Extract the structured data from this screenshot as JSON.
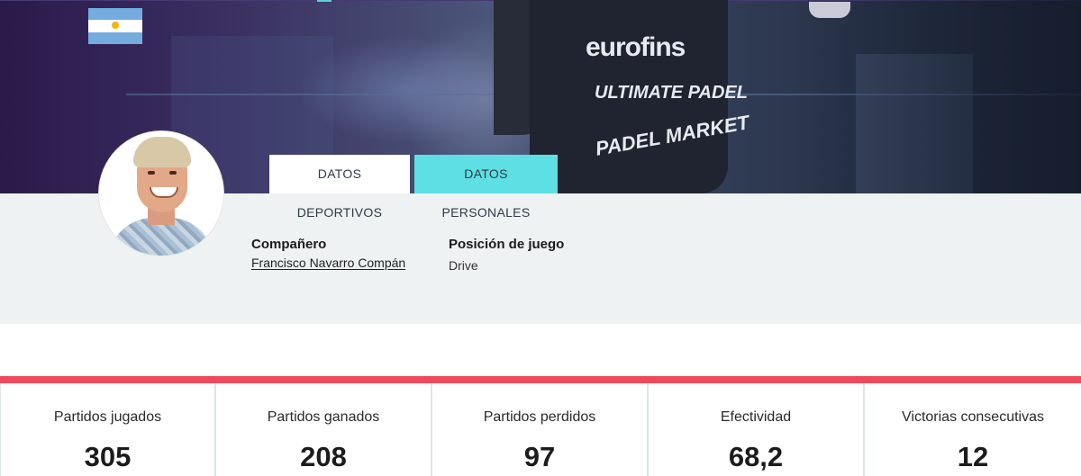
{
  "hero": {
    "flag_country": "Argentina",
    "sponsors": [
      "eurofins",
      "ULTIMATE PADEL",
      "PADEL MARKET"
    ]
  },
  "tabs": [
    {
      "label": "DATOS DEPORTIVOS",
      "active": true
    },
    {
      "label": "DATOS PERSONALES",
      "active": false
    }
  ],
  "profile": {
    "partner_label": "Compañero",
    "partner_name": "Francisco Navarro Compán",
    "position_label": "Posición de juego",
    "position_value": "Drive"
  },
  "stats": [
    {
      "label": "Partidos jugados",
      "value": "305"
    },
    {
      "label": "Partidos ganados",
      "value": "208"
    },
    {
      "label": "Partidos perdidos",
      "value": "97"
    },
    {
      "label": "Efectividad",
      "value": "68,2"
    },
    {
      "label": "Victorias consecutivas",
      "value": "12"
    }
  ],
  "colors": {
    "accent_red": "#ef4a5a",
    "tab_cyan": "#5ddfe3",
    "info_band_bg": "#eef2f2"
  }
}
